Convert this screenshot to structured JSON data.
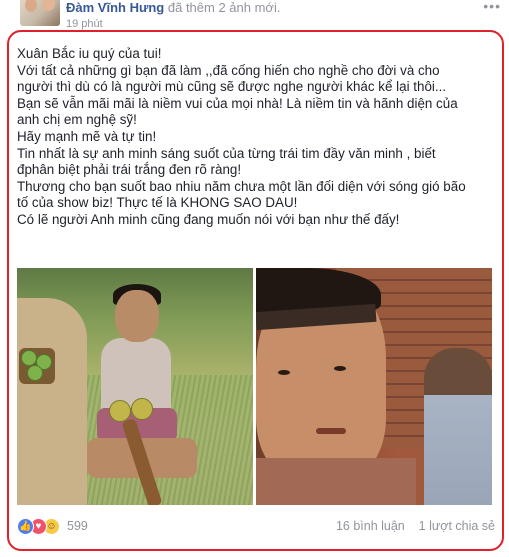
{
  "header": {
    "author": "Đàm Vĩnh Hưng",
    "action": "đã thêm 2 ảnh mới.",
    "timestamp": "19 phút",
    "options_icon": "ellipsis-icon"
  },
  "post": {
    "lines": [
      "Xuân Bắc iu quý của tui!",
      "Với tất cả những gì bạn đã làm ,,đã cống hiến cho nghề cho đời và cho",
      "người thì dù có là người mù cũng sẽ được nghe người khác kể lại thôi...",
      "Bạn sẽ vẫn mãi mãi là niềm vui của mọi nhà! Là niềm tin và hãnh diện của",
      "anh chị em nghệ sỹ!",
      "Hãy mạnh mẽ và tự tin!",
      "Tin nhất là sự anh minh sáng suốt của từng trái tim đầy văn minh , biết",
      "đphân biệt phải trái trắng đen rõ ràng!",
      "Thương cho bạn suốt bao nhiu năm chưa một lần đối diện với sóng gió bão",
      "tố của show biz! Thực tế là KHONG SAO DAU!",
      "Có lẽ người Anh minh cũng đang muốn nói với bạn như thế đấy!"
    ]
  },
  "footer": {
    "reaction_icons": [
      "like-icon",
      "love-icon",
      "haha-icon"
    ],
    "reaction_count": "599",
    "comments": "16 bình luận",
    "shares": "1 lượt chia sẻ"
  },
  "colors": {
    "link": "#365899",
    "meta": "#90949c",
    "highlight": "#e0202a"
  }
}
